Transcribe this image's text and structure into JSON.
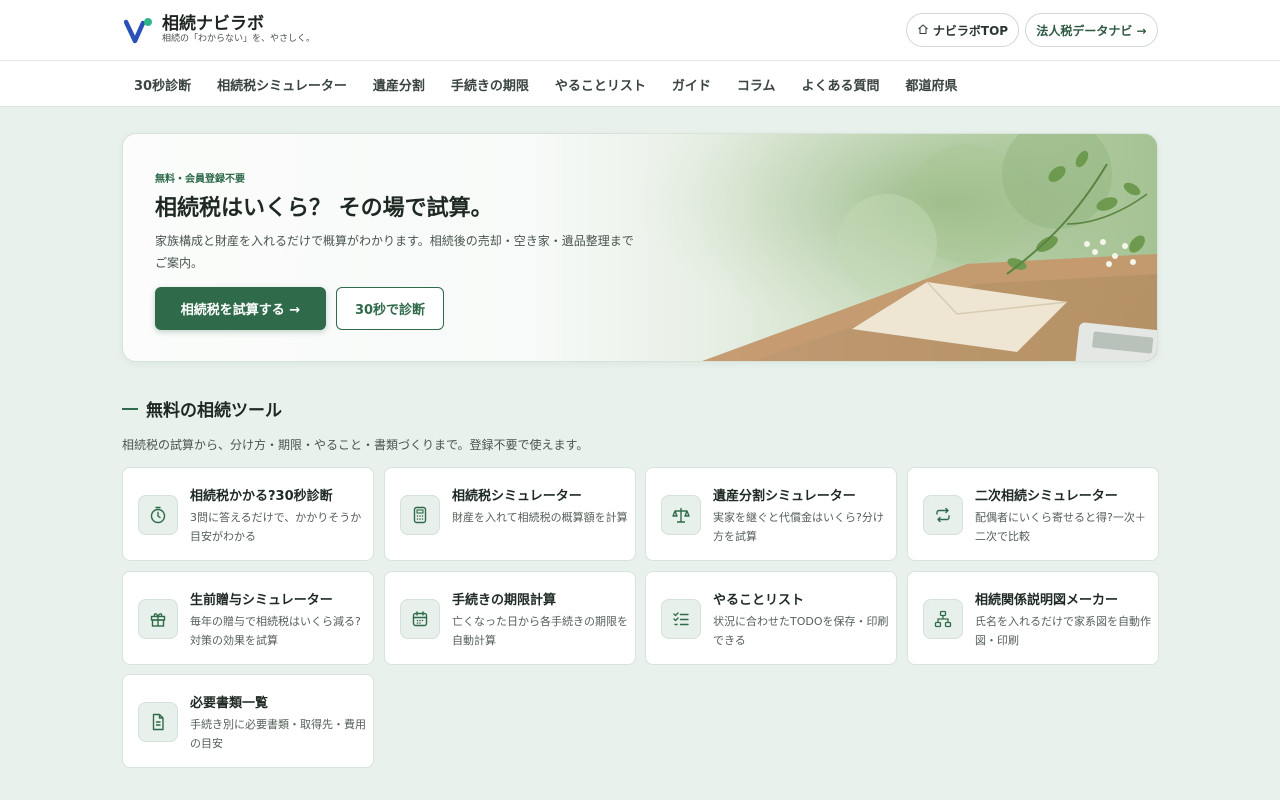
{
  "header": {
    "site_title": "相続ナビラボ",
    "tagline": "相続の「わからない」を、やさしく。",
    "top_button": "ナビラボTOP",
    "corp_button": "法人税データナビ →",
    "logo_icon": "v-logo-icon",
    "home_icon": "home-icon"
  },
  "nav": {
    "items": [
      "30秒診断",
      "相続税シミュレーター",
      "遺産分割",
      "手続きの期限",
      "やることリスト",
      "ガイド",
      "コラム",
      "よくある質問",
      "都道府県"
    ]
  },
  "hero": {
    "badge": "無料・会員登録不要",
    "title": "相続税はいくら？ その場で試算。",
    "description": "家族構成と財産を入れるだけで概算がわかります。相続後の売却・空き家・遺品整理までご案内。",
    "primary_button": "相続税を試算する →",
    "secondary_button": "30秒で診断"
  },
  "tools": {
    "title": "無料の相続ツール",
    "subtitle": "相続税の試算から、分け方・期限・やること・書類づくりまで。登録不要で使えます。",
    "items": [
      {
        "title": "相続税かかる?30秒診断",
        "desc": "3問に答えるだけで、かかりそうか目安がわかる",
        "icon": "timer-icon"
      },
      {
        "title": "相続税シミュレーター",
        "desc": "財産を入れて相続税の概算額を計算",
        "icon": "calculator-icon"
      },
      {
        "title": "遺産分割シミュレーター",
        "desc": "実家を継ぐと代償金はいくら?分け方を試算",
        "icon": "scale-icon"
      },
      {
        "title": "二次相続シミュレーター",
        "desc": "配偶者にいくら寄せると得?一次＋二次で比較",
        "icon": "repeat-icon"
      },
      {
        "title": "生前贈与シミュレーター",
        "desc": "毎年の贈与で相続税はいくら減る?対策の効果を試算",
        "icon": "gift-icon"
      },
      {
        "title": "手続きの期限計算",
        "desc": "亡くなった日から各手続きの期限を自動計算",
        "icon": "calendar-icon"
      },
      {
        "title": "やることリスト",
        "desc": "状況に合わせたTODOを保存・印刷できる",
        "icon": "checklist-icon"
      },
      {
        "title": "相続関係説明図メーカー",
        "desc": "氏名を入れるだけで家系図を自動作図・印刷",
        "icon": "family-tree-icon"
      },
      {
        "title": "必要書類一覧",
        "desc": "手続き別に必要書類・取得先・費用の目安",
        "icon": "document-icon"
      }
    ]
  },
  "colors": {
    "accent": "#2f6b4a",
    "background": "#e9f1ec",
    "logo_blue": "#2b50b8",
    "logo_teal": "#2fb58a"
  }
}
